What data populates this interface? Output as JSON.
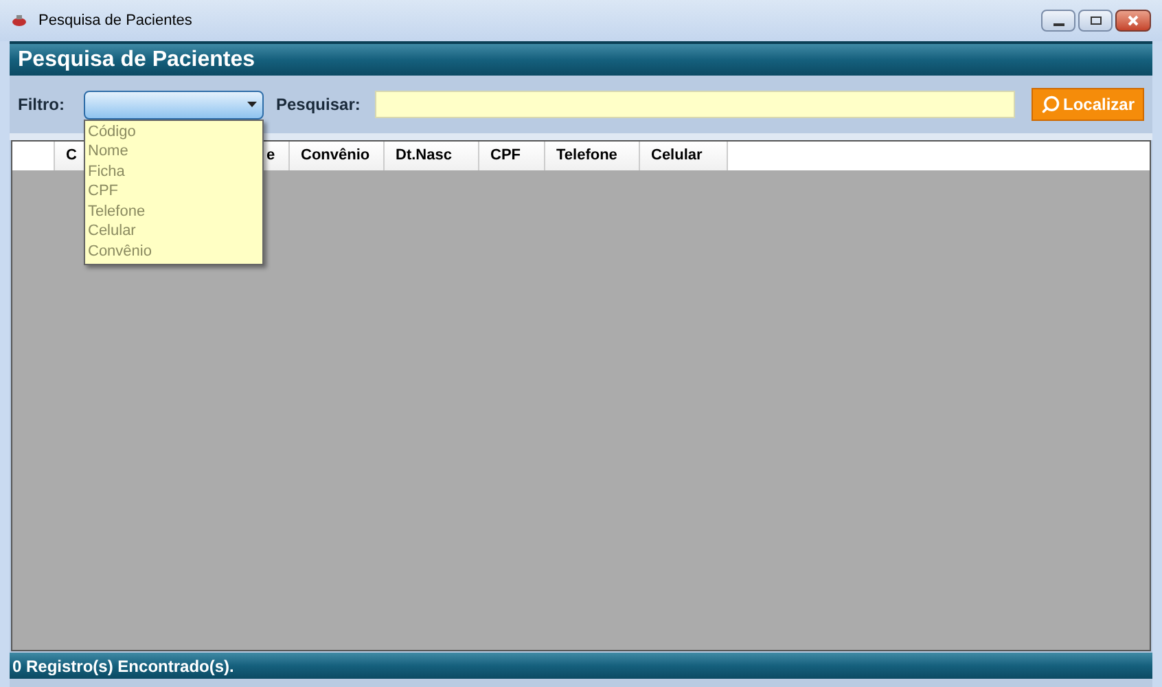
{
  "window": {
    "title": "Pesquisa de Pacientes"
  },
  "header": {
    "title": "Pesquisa de Pacientes"
  },
  "filter": {
    "label": "Filtro:",
    "expanded": true,
    "options": [
      {
        "label": "Código"
      },
      {
        "label": "Nome"
      },
      {
        "label": "Ficha"
      },
      {
        "label": "CPF"
      },
      {
        "label": "Telefone"
      },
      {
        "label": "Celular"
      },
      {
        "label": "Convênio"
      }
    ]
  },
  "search": {
    "label": "Pesquisar:",
    "button": "Localizar"
  },
  "table": {
    "columns": [
      {
        "label": "C"
      },
      {
        "label": "e"
      },
      {
        "label": "Convênio"
      },
      {
        "label": "Dt.Nasc"
      },
      {
        "label": "CPF"
      },
      {
        "label": "Telefone"
      },
      {
        "label": "Celular"
      }
    ]
  },
  "status_bar": {
    "text": "0 Registro(s) Encontrado(s)."
  }
}
